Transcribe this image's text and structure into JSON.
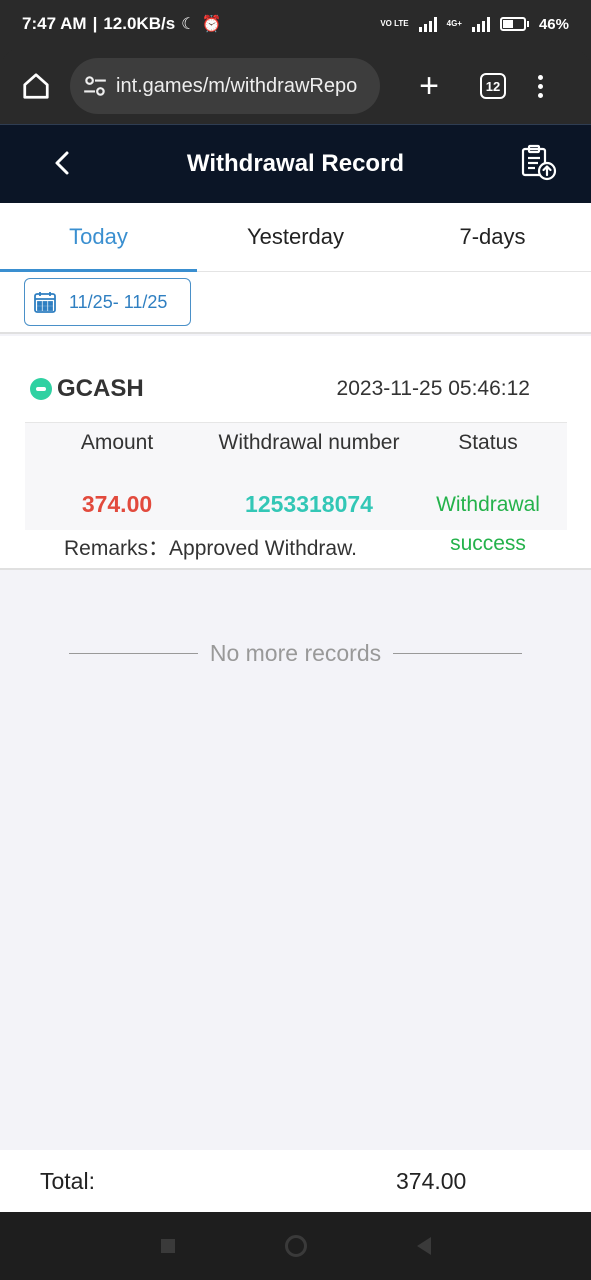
{
  "status_bar": {
    "time": "7:47 AM",
    "speed": "12.0KB/s",
    "volte": "VO LTE",
    "network": "4G+",
    "battery": "46%"
  },
  "browser": {
    "url": "int.games/m/withdrawRepo",
    "tab_count": "12"
  },
  "header": {
    "title": "Withdrawal Record"
  },
  "tabs": [
    {
      "label": "Today",
      "active": true
    },
    {
      "label": "Yesterday",
      "active": false
    },
    {
      "label": "7-days",
      "active": false
    }
  ],
  "date_range": "11/25- 11/25",
  "record": {
    "method": "GCASH",
    "datetime": "2023-11-25 05:46:12",
    "headers": {
      "amount": "Amount",
      "number": "Withdrawal number",
      "status": "Status"
    },
    "amount": "374.00",
    "number": "1253318074",
    "status_line1": "Withdrawal",
    "status_line2": "success",
    "remarks_label": "Remarks：",
    "remarks_value": "Approved Withdraw."
  },
  "no_more_text": "No more records",
  "total": {
    "label": "Total:",
    "value": "374.00"
  },
  "colors": {
    "accent": "#3a8fd0",
    "header_bg": "#0b1526",
    "amount": "#e24a3d",
    "number": "#33c7b6",
    "success": "#24b24b"
  }
}
